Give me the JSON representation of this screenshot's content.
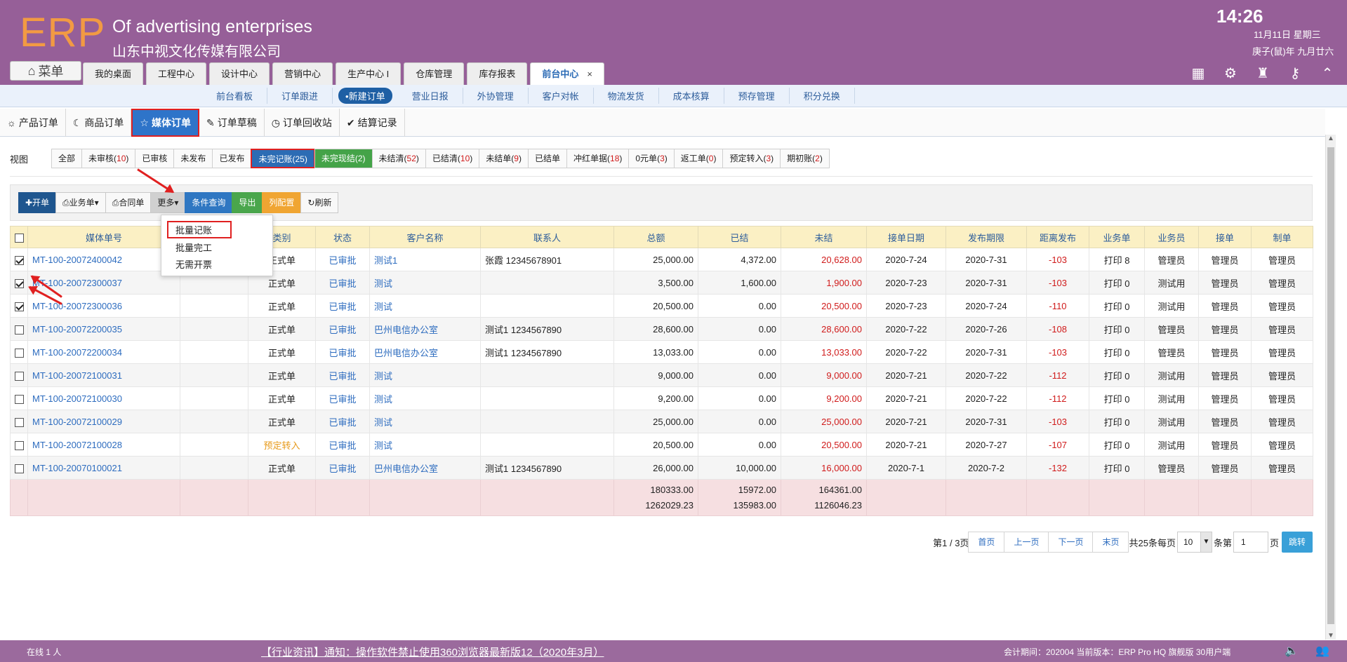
{
  "header": {
    "logo": "ERP",
    "brand_en": "Of advertising enterprises",
    "brand_cn": "山东中视文化传媒有限公司",
    "time": "14:26",
    "date_line1": "11月11日 星期三",
    "date_line2": "庚子(鼠)年 九月廿六",
    "menu_label": "菜单"
  },
  "tabs": [
    {
      "label": "我的桌面"
    },
    {
      "label": "工程中心"
    },
    {
      "label": "设计中心"
    },
    {
      "label": "营销中心"
    },
    {
      "label": "生产中心 I"
    },
    {
      "label": "仓库管理"
    },
    {
      "label": "库存报表"
    },
    {
      "label": "前台中心"
    }
  ],
  "tab_close": "×",
  "subnav": [
    "前台看板",
    "订单跟进",
    "•新建订单",
    "营业日报",
    "外协管理",
    "客户对帐",
    "物流发货",
    "成本核算",
    "预存管理",
    "积分兑换"
  ],
  "order_tabs": [
    {
      "label": "产品订单",
      "icon": "☼"
    },
    {
      "label": "商品订单",
      "icon": "☾"
    },
    {
      "label": "媒体订单",
      "icon": "☆"
    },
    {
      "label": "订单草稿",
      "icon": "✎"
    },
    {
      "label": "订单回收站",
      "icon": "◷"
    },
    {
      "label": "结算记录",
      "icon": "✔"
    }
  ],
  "view": {
    "label": "视图",
    "buttons": [
      {
        "label": "全部",
        "count": ""
      },
      {
        "label": "未审核",
        "count": "10"
      },
      {
        "label": "已审核",
        "count": ""
      },
      {
        "label": "未发布",
        "count": ""
      },
      {
        "label": "已发布",
        "count": ""
      },
      {
        "label": "未完记账",
        "count": "25"
      },
      {
        "label": "未完现结",
        "count": "2"
      },
      {
        "label": "未结清",
        "count": "52"
      },
      {
        "label": "已结清",
        "count": "10"
      },
      {
        "label": "未结单",
        "count": "9"
      },
      {
        "label": "已结单",
        "count": ""
      },
      {
        "label": "冲红单据",
        "count": "18"
      },
      {
        "label": "0元单",
        "count": "3"
      },
      {
        "label": "返工单",
        "count": "0"
      },
      {
        "label": "预定转入",
        "count": "3"
      },
      {
        "label": "期初账",
        "count": "2"
      }
    ]
  },
  "toolbar": {
    "new": "✚开单",
    "biz": "业务单▾",
    "contract": "合同单",
    "more": "更多▾",
    "query": "条件查询",
    "export": "导出",
    "config": "列配置",
    "refresh": "刷新"
  },
  "dropdown": [
    "批量记账",
    "批量完工",
    "无需开票"
  ],
  "table": {
    "headers": [
      "",
      "媒体单号",
      "",
      "类别",
      "状态",
      "客户名称",
      "联系人",
      "总额",
      "已结",
      "未结",
      "接单日期",
      "发布期限",
      "距离发布",
      "业务单",
      "业务员",
      "接单",
      "制单"
    ],
    "rows": [
      {
        "checked": true,
        "no": "MT-100-20072400042",
        "type": "正式单",
        "status": "已审批",
        "customer": "测试1",
        "contact": "张霞 12345678901",
        "total": "25,000.00",
        "paid": "4,372.00",
        "unpaid": "20,628.00",
        "date": "2020-7-24",
        "deadline": "2020-7-31",
        "dist": "-103",
        "print": "打印 8",
        "sales": "管理员",
        "recv": "管理员",
        "maker": "管理员"
      },
      {
        "checked": true,
        "no": "MT-100-20072300037",
        "type": "正式单",
        "status": "已审批",
        "customer": "测试",
        "contact": "",
        "total": "3,500.00",
        "paid": "1,600.00",
        "unpaid": "1,900.00",
        "date": "2020-7-23",
        "deadline": "2020-7-31",
        "dist": "-103",
        "print": "打印 0",
        "sales": "测试用",
        "recv": "管理员",
        "maker": "管理员"
      },
      {
        "checked": true,
        "no": "MT-100-20072300036",
        "type": "正式单",
        "status": "已审批",
        "customer": "测试",
        "contact": "",
        "total": "20,500.00",
        "paid": "0.00",
        "unpaid": "20,500.00",
        "date": "2020-7-23",
        "deadline": "2020-7-24",
        "dist": "-110",
        "print": "打印 0",
        "sales": "测试用",
        "recv": "管理员",
        "maker": "管理员"
      },
      {
        "checked": false,
        "no": "MT-100-20072200035",
        "type": "正式单",
        "status": "已审批",
        "customer": "巴州电信办公室",
        "contact": "测试1 1234567890",
        "total": "28,600.00",
        "paid": "0.00",
        "unpaid": "28,600.00",
        "date": "2020-7-22",
        "deadline": "2020-7-26",
        "dist": "-108",
        "print": "打印 0",
        "sales": "管理员",
        "recv": "管理员",
        "maker": "管理员"
      },
      {
        "checked": false,
        "no": "MT-100-20072200034",
        "type": "正式单",
        "status": "已审批",
        "customer": "巴州电信办公室",
        "contact": "测试1 1234567890",
        "total": "13,033.00",
        "paid": "0.00",
        "unpaid": "13,033.00",
        "date": "2020-7-22",
        "deadline": "2020-7-31",
        "dist": "-103",
        "print": "打印 0",
        "sales": "管理员",
        "recv": "管理员",
        "maker": "管理员"
      },
      {
        "checked": false,
        "no": "MT-100-20072100031",
        "type": "正式单",
        "status": "已审批",
        "customer": "测试",
        "contact": "",
        "total": "9,000.00",
        "paid": "0.00",
        "unpaid": "9,000.00",
        "date": "2020-7-21",
        "deadline": "2020-7-22",
        "dist": "-112",
        "print": "打印 0",
        "sales": "测试用",
        "recv": "管理员",
        "maker": "管理员"
      },
      {
        "checked": false,
        "no": "MT-100-20072100030",
        "type": "正式单",
        "status": "已审批",
        "customer": "测试",
        "contact": "",
        "total": "9,200.00",
        "paid": "0.00",
        "unpaid": "9,200.00",
        "date": "2020-7-21",
        "deadline": "2020-7-22",
        "dist": "-112",
        "print": "打印 0",
        "sales": "测试用",
        "recv": "管理员",
        "maker": "管理员"
      },
      {
        "checked": false,
        "no": "MT-100-20072100029",
        "type": "正式单",
        "status": "已审批",
        "customer": "测试",
        "contact": "",
        "total": "25,000.00",
        "paid": "0.00",
        "unpaid": "25,000.00",
        "date": "2020-7-21",
        "deadline": "2020-7-31",
        "dist": "-103",
        "print": "打印 0",
        "sales": "测试用",
        "recv": "管理员",
        "maker": "管理员"
      },
      {
        "checked": false,
        "no": "MT-100-20072100028",
        "type": "预定转入",
        "status": "已审批",
        "customer": "测试",
        "contact": "",
        "total": "20,500.00",
        "paid": "0.00",
        "unpaid": "20,500.00",
        "date": "2020-7-21",
        "deadline": "2020-7-27",
        "dist": "-107",
        "print": "打印 0",
        "sales": "测试用",
        "recv": "管理员",
        "maker": "管理员"
      },
      {
        "checked": false,
        "no": "MT-100-20070100021",
        "type": "正式单",
        "status": "已审批",
        "customer": "巴州电信办公室",
        "contact": "测试1 1234567890",
        "total": "26,000.00",
        "paid": "10,000.00",
        "unpaid": "16,000.00",
        "date": "2020-7-1",
        "deadline": "2020-7-2",
        "dist": "-132",
        "print": "打印 0",
        "sales": "管理员",
        "recv": "管理员",
        "maker": "管理员"
      }
    ],
    "sum": {
      "total1": "180333.00",
      "total2": "1262029.23",
      "paid1": "15972.00",
      "paid2": "135983.00",
      "unpaid1": "164361.00",
      "unpaid2": "1126046.23"
    }
  },
  "pager": {
    "info": "第1 / 3页",
    "first": "首页",
    "prev": "上一页",
    "next": "下一页",
    "last": "末页",
    "total": "共25条每页",
    "size": "10",
    "unit": "条第",
    "page": "1",
    "page_unit": "页",
    "jump": "跳转"
  },
  "footer": {
    "online": "在线  1  人",
    "notice": "【行业资讯】通知：操作软件禁止使用360浏览器最新版12（2020年3月）",
    "period": "会计期间：202004 当前版本：ERP Pro HQ 旗舰版 30用户端"
  }
}
